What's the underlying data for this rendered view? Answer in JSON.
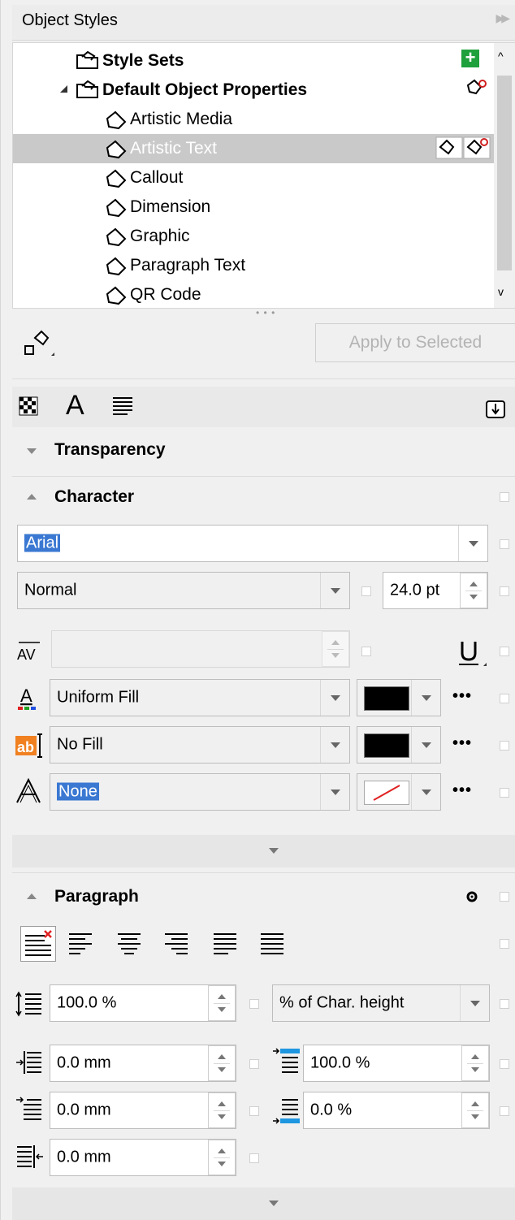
{
  "panel": {
    "title": "Object Styles",
    "collapse_icon": "double-chevron-right-icon"
  },
  "tree": {
    "items": [
      {
        "label": "Style Sets",
        "level": 0,
        "bold": true,
        "icon": "style-set-folder-icon"
      },
      {
        "label": "Default Object Properties",
        "level": 0,
        "bold": true,
        "expanded": true,
        "icon": "style-set-folder-icon"
      },
      {
        "label": "Artistic Media",
        "level": 1,
        "icon": "style-icon"
      },
      {
        "label": "Artistic Text",
        "level": 1,
        "icon": "style-icon",
        "selected": true
      },
      {
        "label": "Callout",
        "level": 1,
        "icon": "style-icon"
      },
      {
        "label": "Dimension",
        "level": 1,
        "icon": "style-icon"
      },
      {
        "label": "Graphic",
        "level": 1,
        "icon": "style-icon"
      },
      {
        "label": "Paragraph Text",
        "level": 1,
        "icon": "style-icon"
      },
      {
        "label": "QR Code",
        "level": 1,
        "icon": "style-icon"
      }
    ]
  },
  "apply": {
    "label": "Apply to Selected"
  },
  "tabs": [
    "transparency-tab-icon",
    "character-tab-icon",
    "paragraph-tab-icon",
    "import-export-icon"
  ],
  "transparency": {
    "label": "Transparency"
  },
  "character": {
    "label": "Character",
    "font": "Arial",
    "style": "Normal",
    "size": "24.0 pt",
    "text_fill": "Uniform Fill",
    "text_fill_color": "#000000",
    "bg_fill": "No Fill",
    "bg_fill_color": "#000000",
    "outline": "None",
    "outline_color": "#e02020",
    "more": "•••"
  },
  "paragraph": {
    "label": "Paragraph",
    "line_spacing": "100.0 %",
    "spacing_unit": "% of Char. height",
    "before_indent": "0.0 mm",
    "before_para": "100.0 %",
    "first_indent": "0.0 mm",
    "after_para": "0.0 %",
    "right_indent": "0.0 mm"
  }
}
